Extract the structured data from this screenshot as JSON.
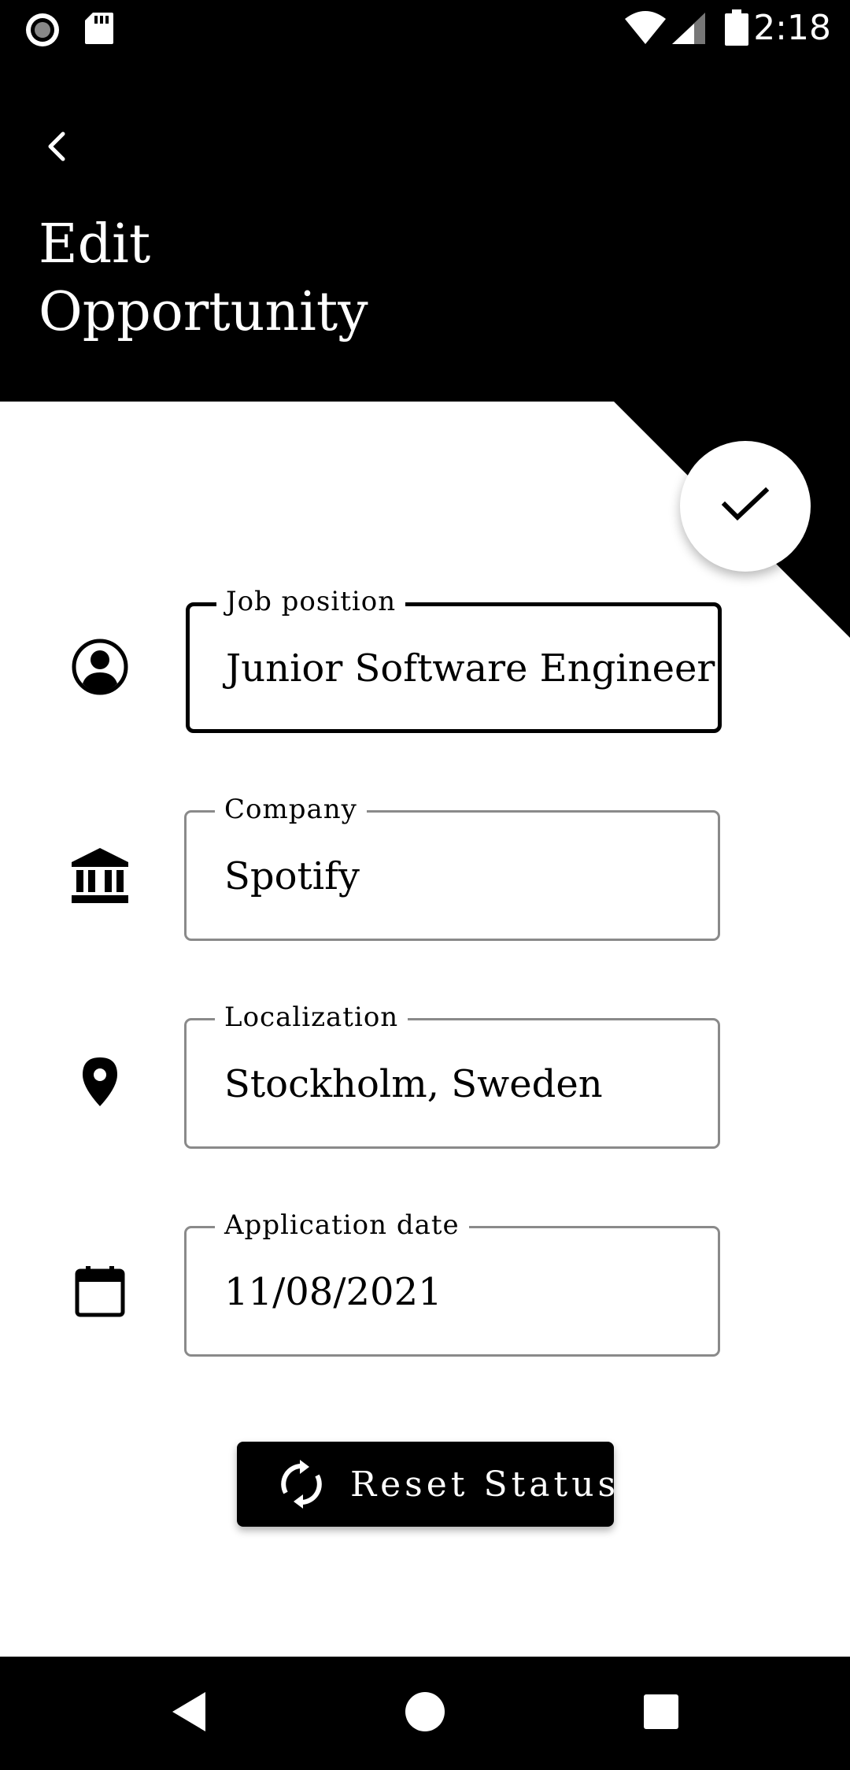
{
  "status_bar": {
    "time": "2:18",
    "icons": [
      "record-icon",
      "sd-card-icon",
      "wifi-icon",
      "signal-icon",
      "battery-icon"
    ]
  },
  "header": {
    "back_icon": "chevron-left-icon",
    "title_line1": "Edit",
    "title_line2": "Opportunity"
  },
  "save_fab": {
    "icon": "check-icon"
  },
  "form": {
    "fields": [
      {
        "icon": "account-circle-icon",
        "label": "Job position",
        "value": "Junior Software Engineer",
        "focused": true
      },
      {
        "icon": "bank-icon",
        "label": "Company",
        "value": "Spotify",
        "focused": false
      },
      {
        "icon": "location-pin-icon",
        "label": "Localization",
        "value": "Stockholm, Sweden",
        "focused": false
      },
      {
        "icon": "calendar-icon",
        "label": "Application date",
        "value": "11/08/2021",
        "focused": false
      }
    ]
  },
  "reset_button": {
    "icon": "sync-icon",
    "label": "Reset Status"
  },
  "nav_bar": {
    "icons": [
      "back-triangle-icon",
      "home-circle-icon",
      "recents-square-icon"
    ]
  },
  "colors": {
    "primary": "#000000",
    "background": "#ffffff",
    "outline": "#8a8a8a"
  }
}
